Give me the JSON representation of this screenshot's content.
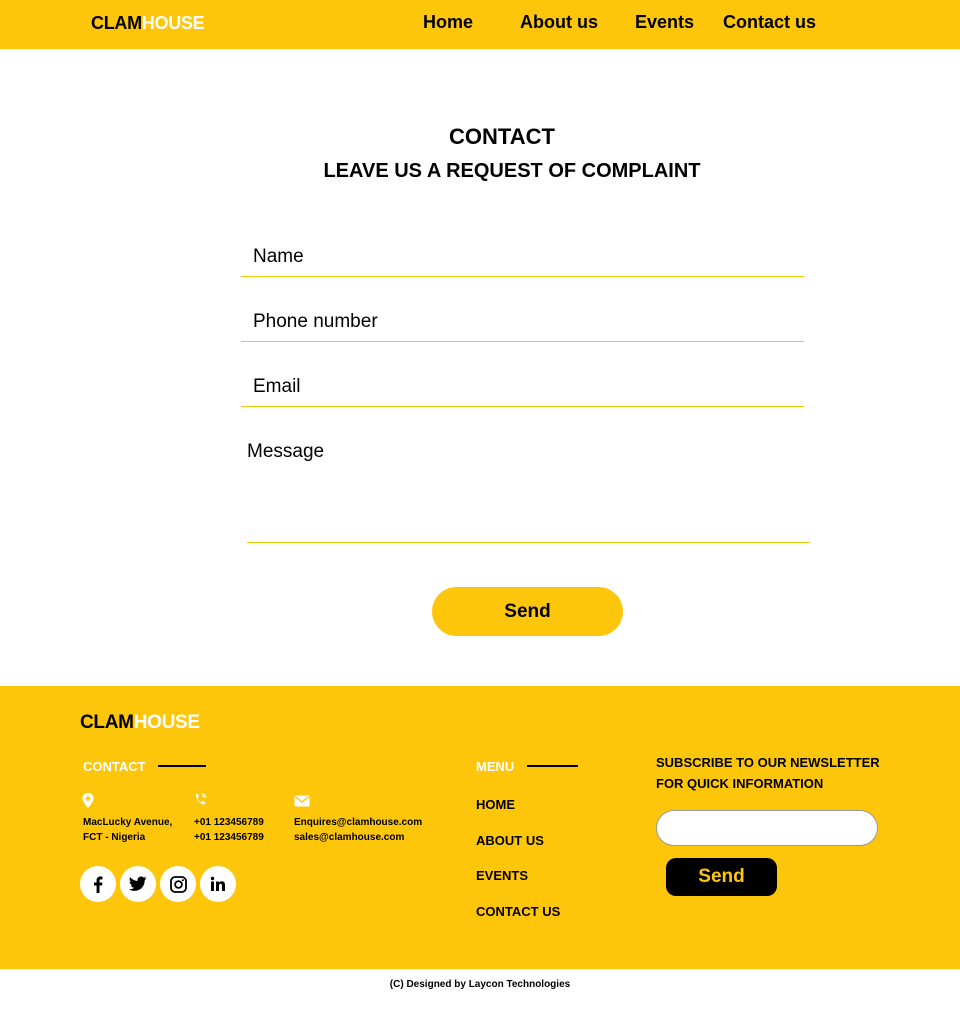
{
  "header": {
    "logo_dark": "CLAM",
    "logo_light": "HOUSE",
    "nav": [
      "Home",
      "About us",
      "Events",
      "Contact us"
    ]
  },
  "main": {
    "title": "CONTACT",
    "subtitle": "LEAVE US A REQUEST OF COMPLAINT",
    "fields": {
      "name": "Name",
      "phone": "Phone number",
      "email": "Email",
      "message": "Message"
    },
    "send_label": "Send"
  },
  "footer": {
    "logo_dark": "CLAM",
    "logo_light": "HOUSE",
    "contact_title": "CONTACT",
    "address_line1": "MacLucky Avenue,",
    "address_line2": "FCT - Nigeria",
    "phone1": "+01 123456789",
    "phone2": "+01 123456789",
    "email1": "Enquires@clamhouse.com",
    "email2": "sales@clamhouse.com",
    "social_icons": [
      "facebook-icon",
      "twitter-icon",
      "instagram-icon",
      "linkedin-icon"
    ],
    "menu_title": "MENU",
    "menu": [
      "HOME",
      "ABOUT US",
      "EVENTS",
      "CONTACT US"
    ],
    "subscribe_line1": "SUBSCRIBE TO OUR NEWSLETTER",
    "subscribe_line2": "FOR QUICK INFORMATION",
    "subscribe_send": "Send"
  },
  "copyright": "(C) Designed by Laycon Technologies",
  "colors": {
    "accent": "#fec60b",
    "text": "#000000",
    "white": "#ffffff"
  }
}
